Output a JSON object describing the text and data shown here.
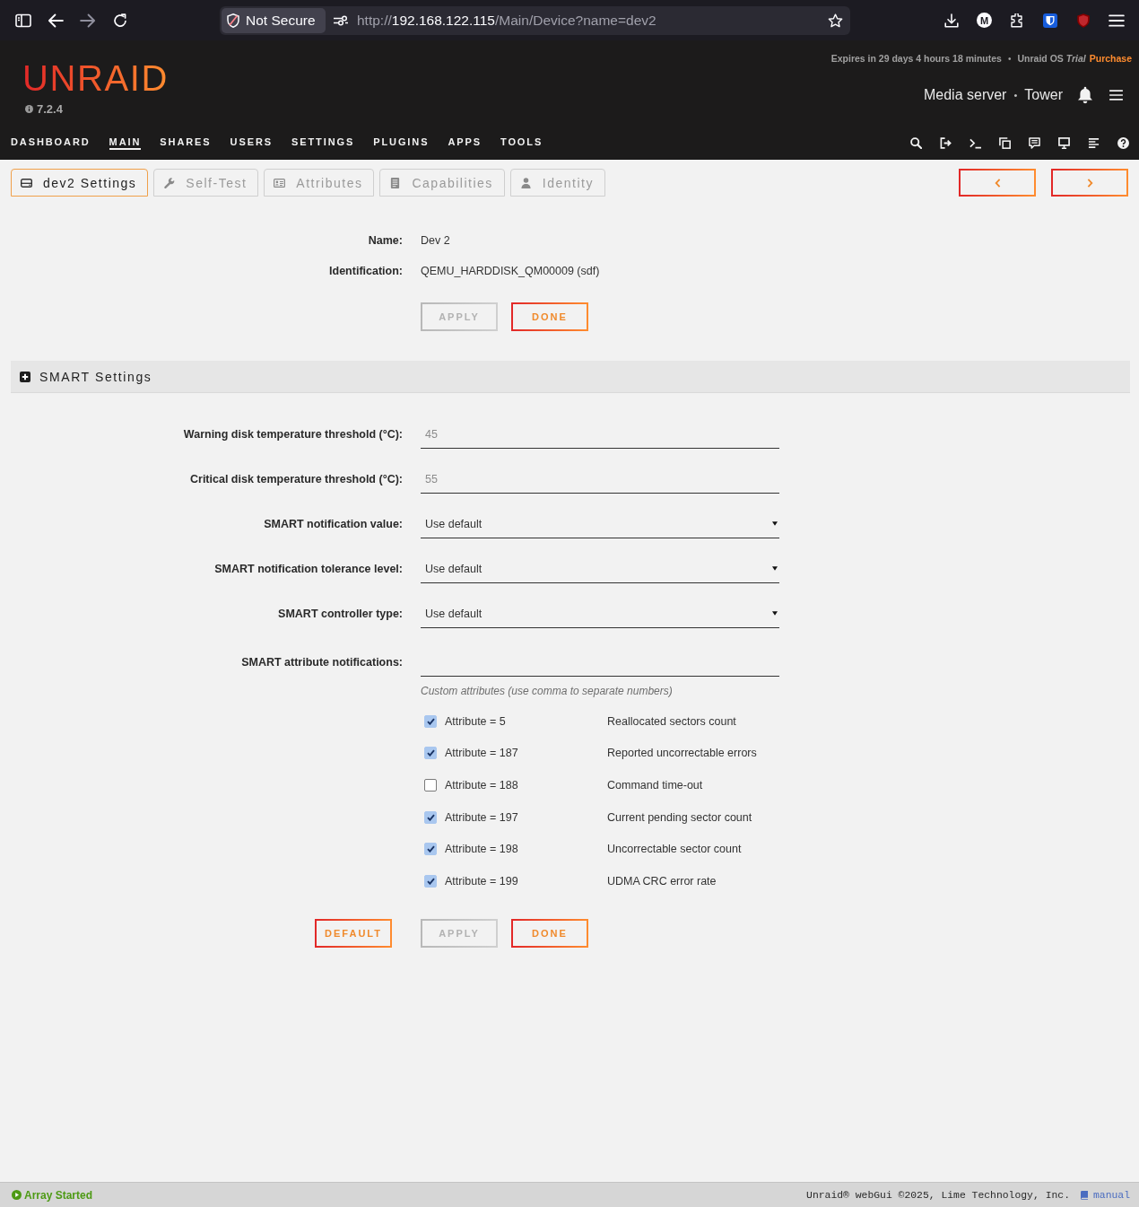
{
  "browser": {
    "security_label": "Not Secure",
    "url": {
      "scheme": "http://",
      "host": "192.168.122.115",
      "path": "/Main/Device?name=dev2"
    },
    "profile_letter": "M"
  },
  "header": {
    "logo": "UNRAID",
    "version": "7.2.4",
    "expiry": "Expires in 29 days 4 hours 18 minutes",
    "expiry_separator": "•",
    "license": "Unraid OS *Trial*",
    "purchase_link": "Purchase",
    "server_description": "Media server",
    "server_separator": "•",
    "server_name": "Tower"
  },
  "nav": [
    {
      "label": "DASHBOARD",
      "selected": false
    },
    {
      "label": "MAIN",
      "selected": true
    },
    {
      "label": "SHARES",
      "selected": false
    },
    {
      "label": "USERS",
      "selected": false
    },
    {
      "label": "SETTINGS",
      "selected": false
    },
    {
      "label": "PLUGINS",
      "selected": false
    },
    {
      "label": "APPS",
      "selected": false
    },
    {
      "label": "TOOLS",
      "selected": false
    }
  ],
  "tabs": [
    {
      "kind": "disk",
      "label": "dev2 Settings",
      "selected": true
    },
    {
      "kind": "wrench",
      "label": "Self-Test",
      "selected": false
    },
    {
      "kind": "card",
      "label": "Attributes",
      "selected": false
    },
    {
      "kind": "document",
      "label": "Capabilities",
      "selected": false
    },
    {
      "kind": "user",
      "label": "Identity",
      "selected": false
    }
  ],
  "device": {
    "fields": [
      {
        "label": "Name:",
        "value": "Dev 2"
      },
      {
        "label": "Identification:",
        "value": "QEMU_HARDDISK_QM00009 (sdf)"
      }
    ],
    "buttons": [
      {
        "label": "APPLY",
        "disabled": true
      },
      {
        "label": "DONE",
        "disabled": false
      }
    ]
  },
  "smart_settings": {
    "title": "SMART Settings",
    "fields": [
      {
        "kind": "number",
        "label": "Warning disk temperature threshold (°C):",
        "placeholder": "45"
      },
      {
        "kind": "number",
        "label": "Critical disk temperature threshold (°C):",
        "placeholder": "55"
      },
      {
        "kind": "select",
        "label": "SMART notification value:",
        "value": "Use default"
      },
      {
        "kind": "select",
        "label": "SMART notification tolerance level:",
        "value": "Use default"
      },
      {
        "kind": "select",
        "label": "SMART controller type:",
        "value": "Use default"
      },
      {
        "kind": "text",
        "label": "SMART attribute notifications:",
        "hint": "Custom attributes (use comma to separate numbers)"
      }
    ],
    "attributes": [
      {
        "label": "Attribute = 5",
        "description": "Reallocated sectors count",
        "checked": true
      },
      {
        "label": "Attribute = 187",
        "description": "Reported uncorrectable errors",
        "checked": true
      },
      {
        "label": "Attribute = 188",
        "description": "Command time-out",
        "checked": false
      },
      {
        "label": "Attribute = 197",
        "description": "Current pending sector count",
        "checked": true
      },
      {
        "label": "Attribute = 198",
        "description": "Uncorrectable sector count",
        "checked": true
      },
      {
        "label": "Attribute = 199",
        "description": "UDMA CRC error rate",
        "checked": true
      }
    ],
    "buttons": [
      {
        "label": "DEFAULT",
        "disabled": false
      },
      {
        "label": "APPLY",
        "disabled": true
      },
      {
        "label": "DONE",
        "disabled": false
      }
    ]
  },
  "footer": {
    "status": "Array Started",
    "copyright": "Unraid® webGui ©2025, Lime Technology, Inc.",
    "manual_link": "manual"
  }
}
